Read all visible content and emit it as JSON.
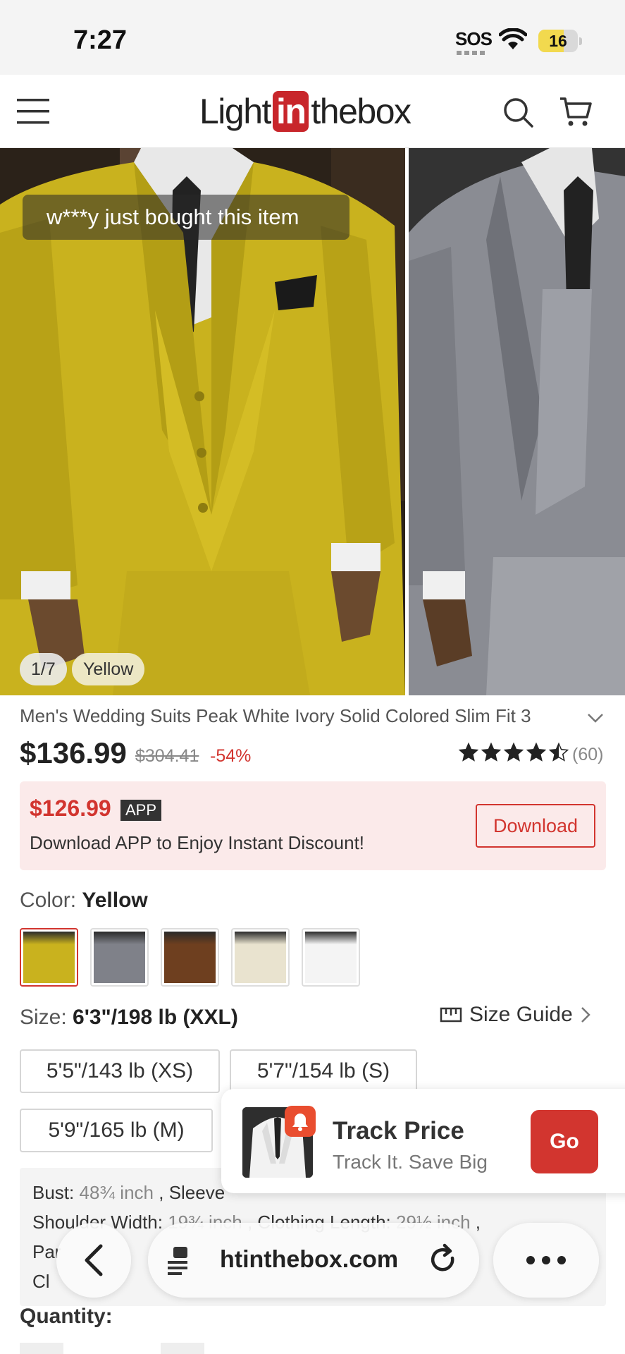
{
  "status": {
    "time": "7:27",
    "sos": "SOS",
    "battery": "16"
  },
  "header": {
    "logo_left": "Light",
    "logo_mid": "in",
    "logo_right": "thebox"
  },
  "gallery": {
    "bought_toast": "w***y just bought this item",
    "counter": "1/7",
    "color_tag": "Yellow"
  },
  "product": {
    "title": "Men's Wedding Suits Peak White Ivory Solid Colored Slim Fit 3",
    "price": "$136.99",
    "old_price": "$304.41",
    "discount": "-54%",
    "rating": 4.5,
    "review_count": "(60)"
  },
  "app_banner": {
    "price": "$126.99",
    "badge": "APP",
    "text": "Download APP to Enjoy Instant Discount!",
    "button": "Download"
  },
  "color": {
    "label": "Color:",
    "value": "Yellow",
    "swatches": [
      "#c9b21e",
      "#7f8189",
      "#6e3f1f",
      "#e9e3cf",
      "#f4f4f4"
    ]
  },
  "size": {
    "label": "Size:",
    "value": "6'3\"/198 lb (XXL)",
    "guide": "Size Guide",
    "options": [
      "5'5\"/143 lb (XS)",
      "5'7\"/154 lb (S)",
      "5'9\"/165 lb (M)"
    ]
  },
  "measurements": {
    "bust_label": "Bust:",
    "bust_value": "48¾ inch",
    "sleeve_label": "Sleeve",
    "shoulder_label": "Shoulder Width:",
    "shoulder_value": "19¾ inch",
    "length_label": "Clothing Length:",
    "length_value": "29½ inch",
    "line3_start": "Par",
    "line4_start": "Cl"
  },
  "quantity": {
    "label": "Quantity:"
  },
  "track_popup": {
    "title": "Track Price",
    "subtitle": "Track It. Save Big",
    "button": "Go"
  },
  "browser": {
    "url": "htinthebox.com"
  },
  "colors": {
    "brand_red": "#d2352f",
    "suit_yellow": "#c9b21e",
    "suit_gray": "#7f8189"
  }
}
